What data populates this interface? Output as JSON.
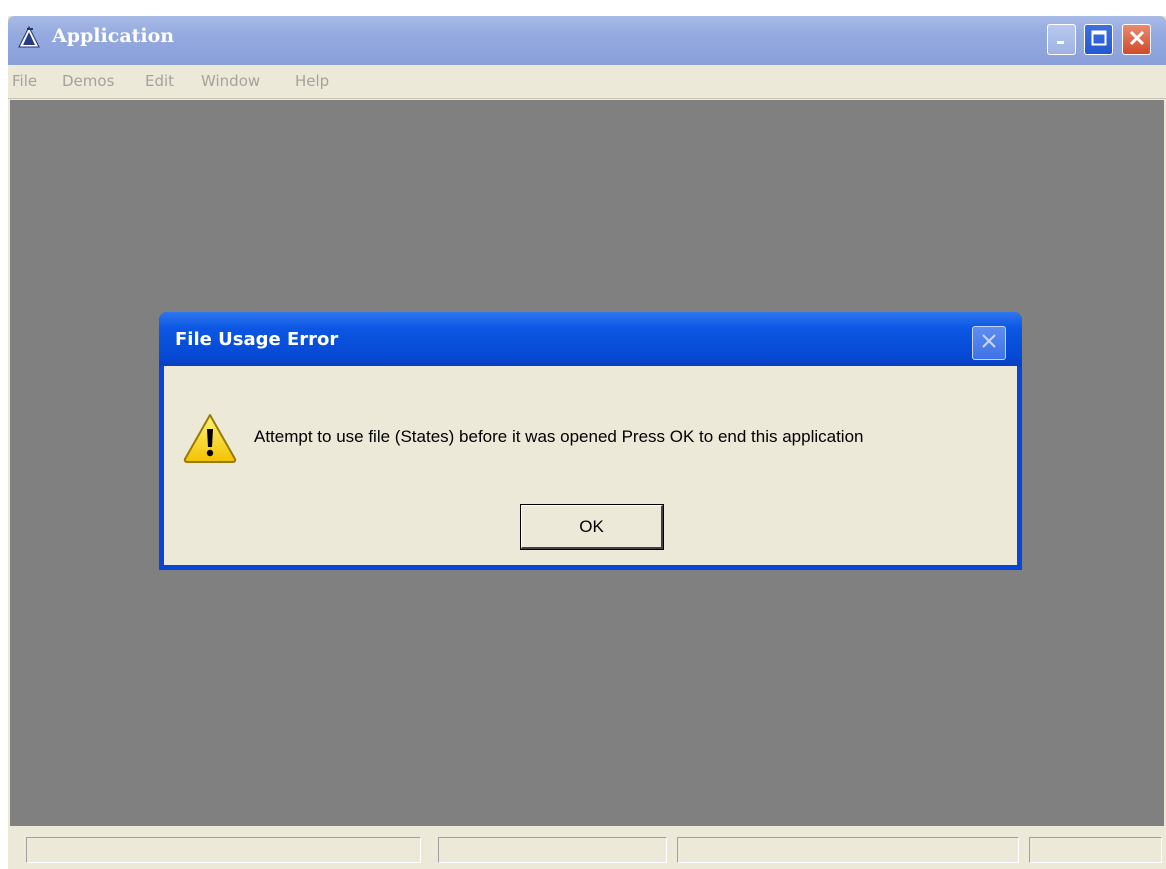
{
  "window": {
    "title": "Application",
    "colors": {
      "titlebar": "#93a9df",
      "client": "#808080",
      "face": "#ece9d8"
    }
  },
  "menu": {
    "items": [
      {
        "label": "File"
      },
      {
        "label": "Demos"
      },
      {
        "label": "Edit"
      },
      {
        "label": "Window"
      },
      {
        "label": "Help"
      }
    ]
  },
  "dialog": {
    "title": "File Usage Error",
    "icon": "warning-icon",
    "message": "Attempt to use file (States) before it was opened  Press OK to end this application",
    "ok_label": "OK",
    "colors": {
      "titlebar": "#0648d3",
      "frame": "#0a46d6"
    }
  },
  "statusbar": {
    "panes": 4
  }
}
